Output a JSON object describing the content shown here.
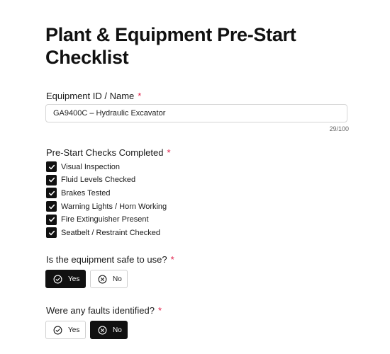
{
  "form": {
    "title": "Plant & Equipment Pre-Start Checklist",
    "required_marker": "*",
    "equipment": {
      "label": "Equipment ID / Name",
      "value": "GA9400C – Hydraulic Excavator",
      "counter": "29/100"
    },
    "checks": {
      "label": "Pre-Start Checks Completed",
      "items": [
        {
          "label": "Visual Inspection",
          "checked": true
        },
        {
          "label": "Fluid Levels Checked",
          "checked": true
        },
        {
          "label": "Brakes Tested",
          "checked": true
        },
        {
          "label": "Warning Lights / Horn Working",
          "checked": true
        },
        {
          "label": "Fire Extinguisher Present",
          "checked": true
        },
        {
          "label": "Seatbelt / Restraint Checked",
          "checked": true
        }
      ]
    },
    "safe_question": {
      "label": "Is the equipment safe to use?",
      "yes_label": "Yes",
      "no_label": "No",
      "selected": "yes"
    },
    "faults_question": {
      "label": "Were any faults identified?",
      "yes_label": "Yes",
      "no_label": "No",
      "selected": "no"
    }
  },
  "icons": {
    "checkmark": "check-icon",
    "yes": "circle-check-icon",
    "no": "circle-x-icon"
  },
  "colors": {
    "accent_dark": "#111111",
    "required": "#e11d48",
    "border": "#d6d6d6"
  }
}
